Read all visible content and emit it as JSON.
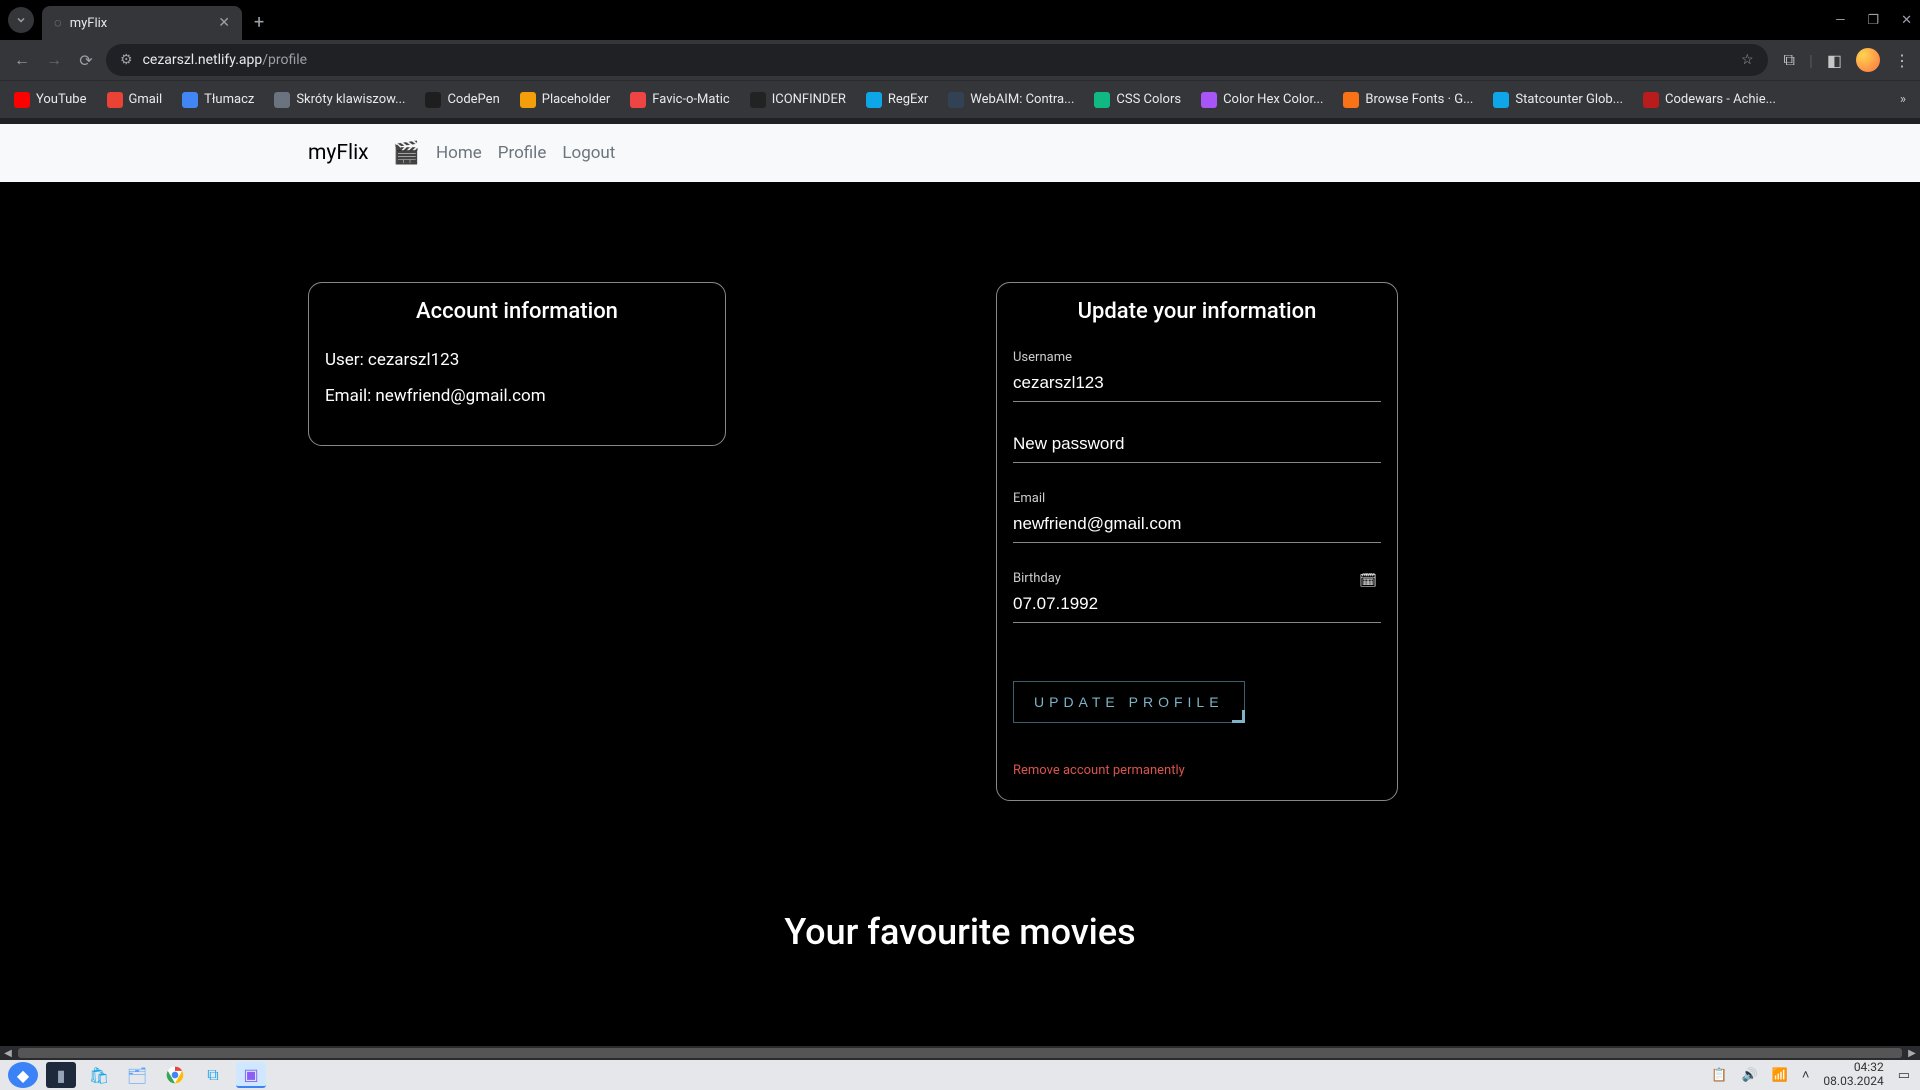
{
  "browser": {
    "tab_title": "myFlix",
    "url_host": "cezarszl.netlify.app",
    "url_path": "/profile"
  },
  "bookmarks": [
    {
      "label": "YouTube",
      "color": "#ff0000"
    },
    {
      "label": "Gmail",
      "color": "#ea4335"
    },
    {
      "label": "Tłumacz",
      "color": "#4285f4"
    },
    {
      "label": "Skróty klawiszow...",
      "color": "#6b7280"
    },
    {
      "label": "CodePen",
      "color": "#1e1e1e"
    },
    {
      "label": "Placeholder",
      "color": "#f59e0b"
    },
    {
      "label": "Favic-o-Matic",
      "color": "#ef4444"
    },
    {
      "label": "ICONFINDER",
      "color": "#222"
    },
    {
      "label": "RegExr",
      "color": "#0ea5e9"
    },
    {
      "label": "WebAIM: Contra...",
      "color": "#334155"
    },
    {
      "label": "CSS Colors",
      "color": "#10b981"
    },
    {
      "label": "Color Hex Color...",
      "color": "#a855f7"
    },
    {
      "label": "Browse Fonts · G...",
      "color": "#f97316"
    },
    {
      "label": "Statcounter Glob...",
      "color": "#0ea5e9"
    },
    {
      "label": "Codewars - Achie...",
      "color": "#b91c1c"
    }
  ],
  "nav": {
    "brand": "myFlix",
    "links": [
      "Home",
      "Profile",
      "Logout"
    ]
  },
  "account": {
    "heading": "Account information",
    "user_label": "User:",
    "user_value": "cezarszl123",
    "email_label": "Email:",
    "email_value": "newfriend@gmail.com"
  },
  "update": {
    "heading": "Update your information",
    "username_label": "Username",
    "username_value": "cezarszl123",
    "password_placeholder": "New password",
    "email_label": "Email",
    "email_value": "newfriend@gmail.com",
    "birthday_label": "Birthday",
    "birthday_value": "07.07.1992",
    "button": "UPDATE PROFILE",
    "remove": "Remove account permanently"
  },
  "favourites_heading": "Your favourite movies",
  "system": {
    "time": "04:32",
    "date": "08.03.2024"
  }
}
